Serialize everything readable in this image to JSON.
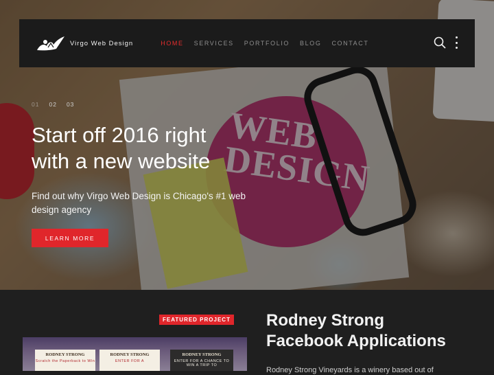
{
  "nav": {
    "logo_text": "Virgo Web Design",
    "links": [
      "HOME",
      "SERVICES",
      "PORTFOLIO",
      "BLOG",
      "CONTACT"
    ],
    "active_index": 0,
    "icons": [
      "search-icon",
      "menu-dots-icon"
    ]
  },
  "hero": {
    "slides": [
      "01",
      "02",
      "03"
    ],
    "title_line1": "Start off 2016 right",
    "title_line2": "with a new website",
    "subtitle": "Find out why Virgo Web Design is Chicago's #1 web design agency",
    "button_label": "LEARN MORE",
    "accent_color": "#e0262b"
  },
  "featured": {
    "badge": "FEATURED PROJECT",
    "title_line1": "Rodney Strong",
    "title_line2": "Facebook Applications",
    "description": "Rodney Strong Vineyards is a winery based out of",
    "image_cards": [
      {
        "brand": "RODNEY STRONG",
        "line": "Scratch the Paperback to Win"
      },
      {
        "brand": "RODNEY STRONG",
        "line": "ENTER FOR A"
      },
      {
        "brand": "RODNEY STRONG",
        "line": "ENTER FOR A CHANCE TO WIN A TRIP TO"
      }
    ]
  }
}
